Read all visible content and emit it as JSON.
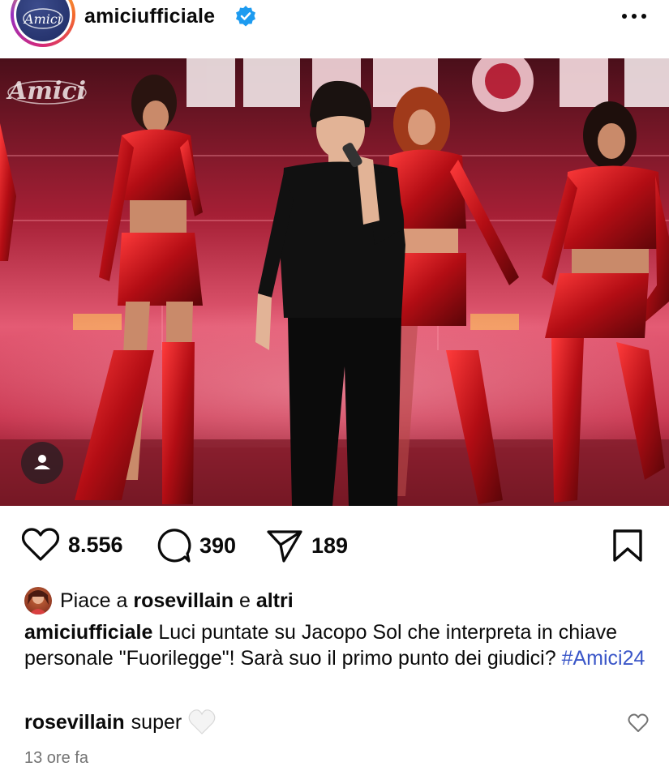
{
  "header": {
    "account_avatar_text": "Amici",
    "username": "amiciufficiale",
    "verified_icon": "verified-badge-icon",
    "more_icon": "more-options-icon"
  },
  "photo": {
    "watermark_text": "Amici",
    "tag_icon": "user-tag-icon"
  },
  "actions": {
    "likes_count": "8.556",
    "comments_count": "390",
    "shares_count": "189",
    "icons": [
      "heart-icon",
      "comment-icon",
      "share-icon",
      "bookmark-icon"
    ]
  },
  "likes_line": {
    "prefix": "Piace a",
    "user": "rosevillain",
    "connector": "e",
    "others": "altri"
  },
  "caption": {
    "user": "amiciufficiale",
    "text": "Luci puntate su Jacopo Sol che interpreta in chiave personale \"Fuorilegge\"! Sarà suo il primo punto dei giudici?",
    "hashtag": "#Amici24"
  },
  "comment": {
    "user": "rosevillain",
    "text": "super",
    "emoji": "white-heart"
  },
  "timestamp": "13 ore fa",
  "colors": {
    "accent_blue": "#3a56c8",
    "verified_blue": "#1d9bf0",
    "muted_gray": "#737373"
  }
}
